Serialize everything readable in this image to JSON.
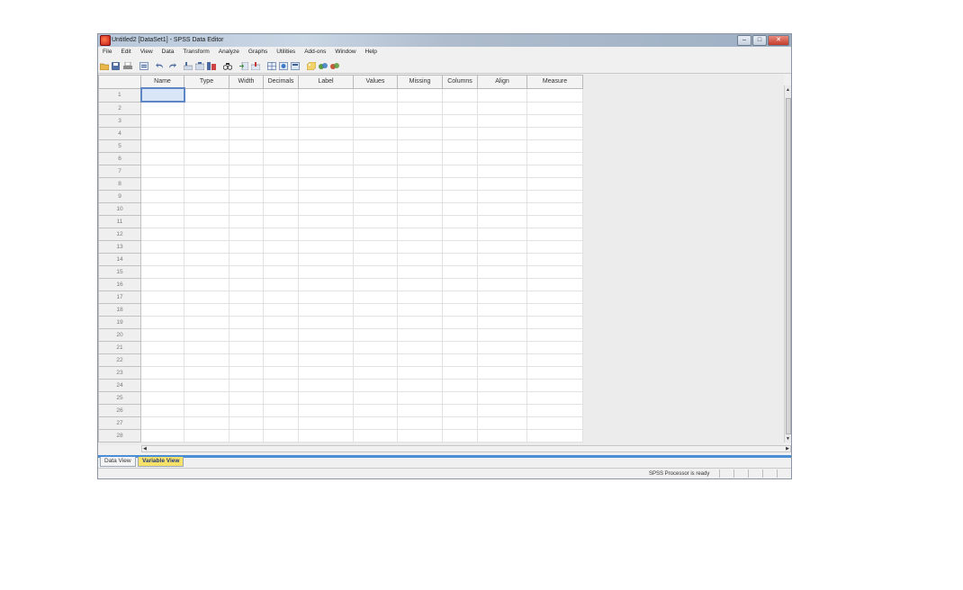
{
  "window": {
    "title": "Untitled2 [DataSet1] - SPSS Data Editor",
    "controls": {
      "minimize": "–",
      "maximize": "□",
      "close": "✕"
    }
  },
  "menu": [
    "File",
    "Edit",
    "View",
    "Data",
    "Transform",
    "Analyze",
    "Graphs",
    "Utilities",
    "Add-ons",
    "Window",
    "Help"
  ],
  "toolbar": [
    "open-folder-icon",
    "save-icon",
    "print-icon",
    "dialog-recall-icon",
    "undo-icon",
    "redo-icon",
    "goto-case-icon",
    "goto-variable-icon",
    "variables-icon",
    "find-icon",
    "insert-cases-icon",
    "insert-variable-icon",
    "split-file-icon",
    "weight-cases-icon",
    "select-cases-icon",
    "value-labels-icon",
    "use-sets-icon",
    "show-all-icon"
  ],
  "grid": {
    "columns": [
      "Name",
      "Type",
      "Width",
      "Decimals",
      "Label",
      "Values",
      "Missing",
      "Columns",
      "Align",
      "Measure"
    ],
    "rows": [
      "1",
      "2",
      "3",
      "4",
      "5",
      "6",
      "7",
      "8",
      "9",
      "10",
      "11",
      "12",
      "13",
      "14",
      "15",
      "16",
      "17",
      "18",
      "19",
      "20",
      "21",
      "22",
      "23",
      "24",
      "25",
      "26",
      "27",
      "28"
    ]
  },
  "tabs": {
    "data_view": "Data View",
    "variable_view": "Variable View"
  },
  "status": {
    "text": "SPSS  Processor is ready"
  },
  "colors": {
    "tab_active": "#f8e26a",
    "tab_strip": "#4a8fd6",
    "selection": "#5f86c4"
  }
}
